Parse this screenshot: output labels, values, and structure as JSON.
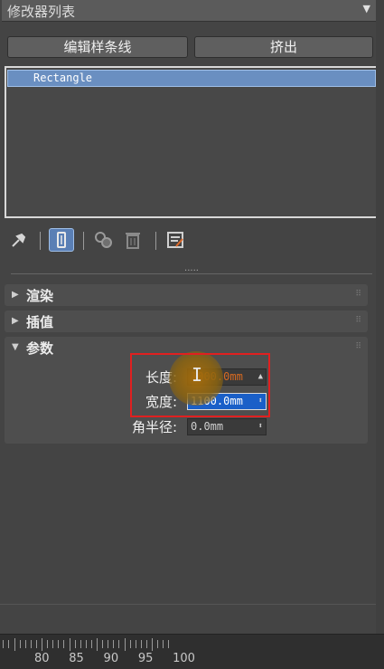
{
  "modifier_list": {
    "label": "修改器列表",
    "arrow_icon": "chevron-down-icon"
  },
  "buttons": {
    "edit_spline": "编辑样条线",
    "extrude": "挤出"
  },
  "stack": {
    "items": [
      "Rectangle"
    ]
  },
  "toolbar": {
    "icons": [
      "pin-stack-icon",
      "show-end-result-icon",
      "make-unique-icon",
      "remove-modifier-icon",
      "configure-modifier-sets-icon"
    ]
  },
  "rollouts": {
    "render": "渲染",
    "interpolation": "插值",
    "params": "参数"
  },
  "params": {
    "length_label": "长度:",
    "length_value": "1000.0mm",
    "width_label": "宽度:",
    "width_value": "1100.0mm",
    "corner_label": "角半径:",
    "corner_value": "0.0mm"
  },
  "timeline": {
    "labels": [
      "80",
      "85",
      "90",
      "95",
      "100"
    ]
  },
  "colors": {
    "selection": "#6a8fc1",
    "active_field": "#1a5fc8",
    "highlight": "#e02020"
  }
}
